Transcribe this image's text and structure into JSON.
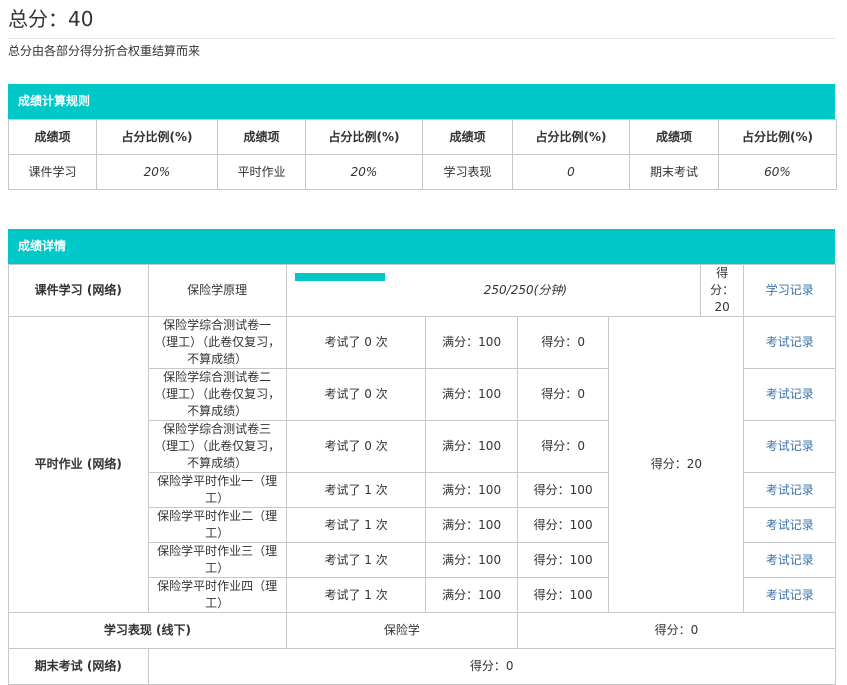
{
  "header": {
    "title_label": "总分：",
    "total_score": "40",
    "subtitle": "总分由各部分得分折合权重结算而来"
  },
  "rules": {
    "section_title": "成绩计算规则",
    "item_header": "成绩项",
    "ratio_header": "占分比例(%)",
    "items": [
      {
        "name": "课件学习",
        "ratio": "20%"
      },
      {
        "name": "平时作业",
        "ratio": "20%"
      },
      {
        "name": "学习表现",
        "ratio": "0"
      },
      {
        "name": "期末考试",
        "ratio": "60%"
      }
    ]
  },
  "details": {
    "section_title": "成绩详情",
    "course": {
      "label": "课件学习 (网络)",
      "course_name": "保险学原理",
      "progress_text": "250/250(分钟)",
      "progress_fraction": 1.0,
      "score": "得分：20",
      "link": "学习记录"
    },
    "homework": {
      "label": "平时作业 (网络)",
      "score": "得分：20",
      "rows": [
        {
          "name": "保险学综合测试卷一（理工）（此卷仅复习，不算成绩）",
          "attempts": "考试了 0 次",
          "full_label": "满分：",
          "full": "100",
          "score_label": "得分：",
          "score": "0",
          "link": "考试记录"
        },
        {
          "name": "保险学综合测试卷二（理工）（此卷仅复习，不算成绩）",
          "attempts": "考试了 0 次",
          "full_label": "满分：",
          "full": "100",
          "score_label": "得分：",
          "score": "0",
          "link": "考试记录"
        },
        {
          "name": "保险学综合测试卷三（理工）（此卷仅复习，不算成绩）",
          "attempts": "考试了 0 次",
          "full_label": "满分：",
          "full": "100",
          "score_label": "得分：",
          "score": "0",
          "link": "考试记录"
        },
        {
          "name": "保险学平时作业一（理工）",
          "attempts": "考试了 1 次",
          "full_label": "满分：",
          "full": "100",
          "score_label": "得分：",
          "score": "100",
          "link": "考试记录"
        },
        {
          "name": "保险学平时作业二（理工）",
          "attempts": "考试了 1 次",
          "full_label": "满分：",
          "full": "100",
          "score_label": "得分：",
          "score": "100",
          "link": "考试记录"
        },
        {
          "name": "保险学平时作业三（理工）",
          "attempts": "考试了 1 次",
          "full_label": "满分：",
          "full": "100",
          "score_label": "得分：",
          "score": "100",
          "link": "考试记录"
        },
        {
          "name": "保险学平时作业四（理工）",
          "attempts": "考试了 1 次",
          "full_label": "满分：",
          "full": "100",
          "score_label": "得分：",
          "score": "100",
          "link": "考试记录"
        }
      ]
    },
    "performance": {
      "label": "学习表现 (线下)",
      "course_name": "保险学",
      "score": "得分：0"
    },
    "final_exam": {
      "label": "期末考试 (网络)",
      "score": "得分：0"
    }
  },
  "colors": {
    "accent": "#00c8c8",
    "link": "#3c73aa",
    "border": "#c8c8c8",
    "text": "#333333"
  }
}
